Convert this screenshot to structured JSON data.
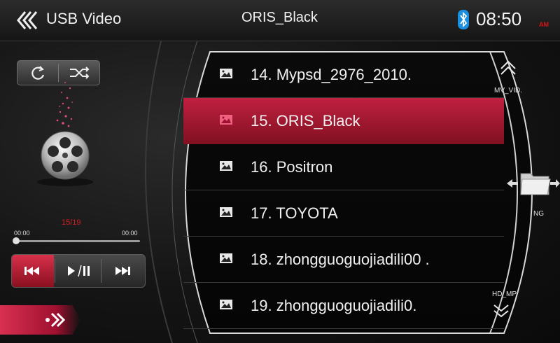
{
  "header": {
    "back_icon": "triple-chevron-left-icon",
    "app_title": "USB Video",
    "now_playing": "ORIS_Black",
    "bluetooth_icon": "bluetooth-icon",
    "clock": "08:50",
    "ampm": "AM"
  },
  "player": {
    "repeat_icon": "repeat-icon",
    "shuffle_icon": "shuffle-icon",
    "track_position": "15/19",
    "elapsed": "00:00",
    "total": "00:00",
    "progress": 0,
    "prev_icon": "previous-track-icon",
    "play_pause_icon": "play-pause-icon",
    "next_icon": "next-track-icon",
    "mode_switch_icon": "forward-chevrons-icon"
  },
  "file_list": {
    "items": [
      {
        "label": "14. Mypsd_2976_2010.",
        "selected": false
      },
      {
        "label": "15. ORIS_Black",
        "selected": true
      },
      {
        "label": "16. Positron",
        "selected": false
      },
      {
        "label": "17. TOYOTA",
        "selected": false
      },
      {
        "label": "18. zhongguoguojiadili00 .",
        "selected": false
      },
      {
        "label": "19. zhongguoguojiadili0.",
        "selected": false
      }
    ]
  },
  "nav": {
    "up_label": "MV_VID.",
    "folder_label": "NG",
    "down_label": "HD_MP."
  },
  "colors": {
    "accent_red": "#c02040",
    "bluetooth_blue": "#1a8fe0",
    "ampm_red": "#d01818"
  }
}
